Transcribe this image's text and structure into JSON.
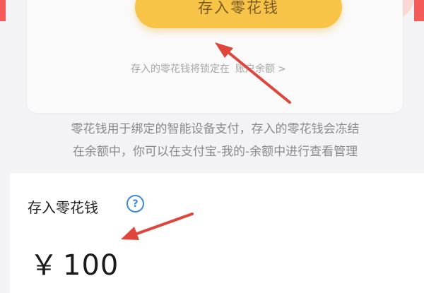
{
  "deposit_button": {
    "label": "存入零花钱"
  },
  "lock_note": {
    "text": "存入的零花钱将锁定在",
    "link": "账户余额",
    "link_arrow": ">"
  },
  "description": {
    "line1": "零花钱用于绑定的智能设备支付，存入的零花钱会冻结",
    "line2": "在余额中，你可以在支付宝-我的-余额中进行查看管理"
  },
  "deposit_section": {
    "title": "存入零花钱",
    "help_icon": "question-circle-icon",
    "currency": "￥",
    "amount": "100"
  },
  "colors": {
    "button": "#f8c447",
    "button_text": "#7a5a26",
    "help_icon": "#3b8ad9",
    "annotation_arrow": "#e0453b",
    "top_edge": "#f45a57"
  }
}
